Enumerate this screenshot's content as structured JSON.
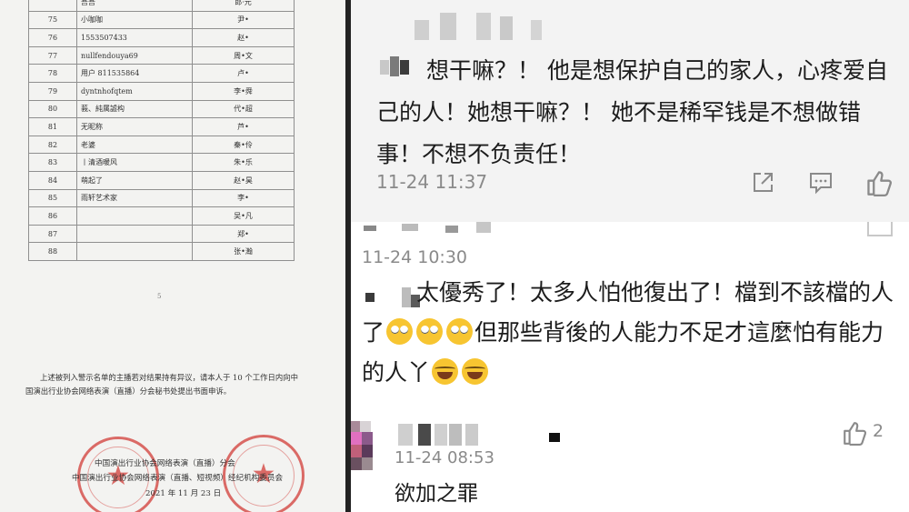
{
  "document": {
    "table_rows": [
      {
        "no": "",
        "nickname": "吾吾",
        "name": "郎·元"
      },
      {
        "no": "75",
        "nickname": "小咖咖",
        "name": "尹•"
      },
      {
        "no": "76",
        "nickname": "1553507433",
        "name": "赵•"
      },
      {
        "no": "77",
        "nickname": "nullfendouya69",
        "name": "周•文"
      },
      {
        "no": "78",
        "nickname": "用户 811535864",
        "name": "卢•"
      },
      {
        "no": "79",
        "nickname": "dyntnhofqtem",
        "name": "李•舜"
      },
      {
        "no": "80",
        "nickname": "莪、純属譃构",
        "name": "代•超"
      },
      {
        "no": "81",
        "nickname": "无昵称",
        "name": "芦•"
      },
      {
        "no": "82",
        "nickname": "老婆",
        "name": "秦•伶"
      },
      {
        "no": "83",
        "nickname": "丨清酒暖风",
        "name": "朱•乐"
      },
      {
        "no": "84",
        "nickname": "萌起了",
        "name": "赵•昊"
      },
      {
        "no": "85",
        "nickname": "雨轩艺术家",
        "name": "李•"
      },
      {
        "no": "86",
        "nickname": "",
        "name": "吴•凡"
      },
      {
        "no": "87",
        "nickname": "",
        "name": "郑•"
      },
      {
        "no": "88",
        "nickname": "",
        "name": "张•瀚"
      }
    ],
    "page_number": "5",
    "notice": "上述被列入警示名单的主播若对结果持有异议，请本人于 10 个工作日内向中国演出行业协会网络表演（直播）分会秘书处提出书面申诉。",
    "signature_1": "中国演出行业协会网络表演（直播）分会",
    "signature_2": "中国演出行业协会网络表演（直播、短视频）经纪机构委员会",
    "date": "2021 年 11 月 23 日",
    "seal_color": "#d23c37"
  },
  "comments": [
    {
      "text": "想干嘛？！ 他是想保护自己的家人，心疼爱自己的人！她想干嘛？！ 她不是稀罕钱是不想做错事！不想不负责任！",
      "time": "11-24 11:37",
      "actions": [
        "share-icon",
        "reply-icon",
        "like-icon"
      ]
    },
    {
      "time": "11-24 10:30",
      "text_parts": [
        "太優秀了！太多人怕他復出了！檔到不該檔的人了",
        "但那些背後的人能力不足才這麼怕有能力的人丫"
      ],
      "emojis": [
        "eye-roll-emoji",
        "eye-roll-emoji",
        "eye-roll-emoji",
        "laugh-cry-emoji",
        "laugh-cry-emoji"
      ]
    },
    {
      "time": "11-24 08:53",
      "text": "欲加之罪",
      "like_count": "2"
    }
  ],
  "colors": {
    "comment_text": "#1c1c1c",
    "meta_text": "#8a8a8a",
    "panel_gray": "#f3f3f3",
    "divider": "#222222"
  }
}
